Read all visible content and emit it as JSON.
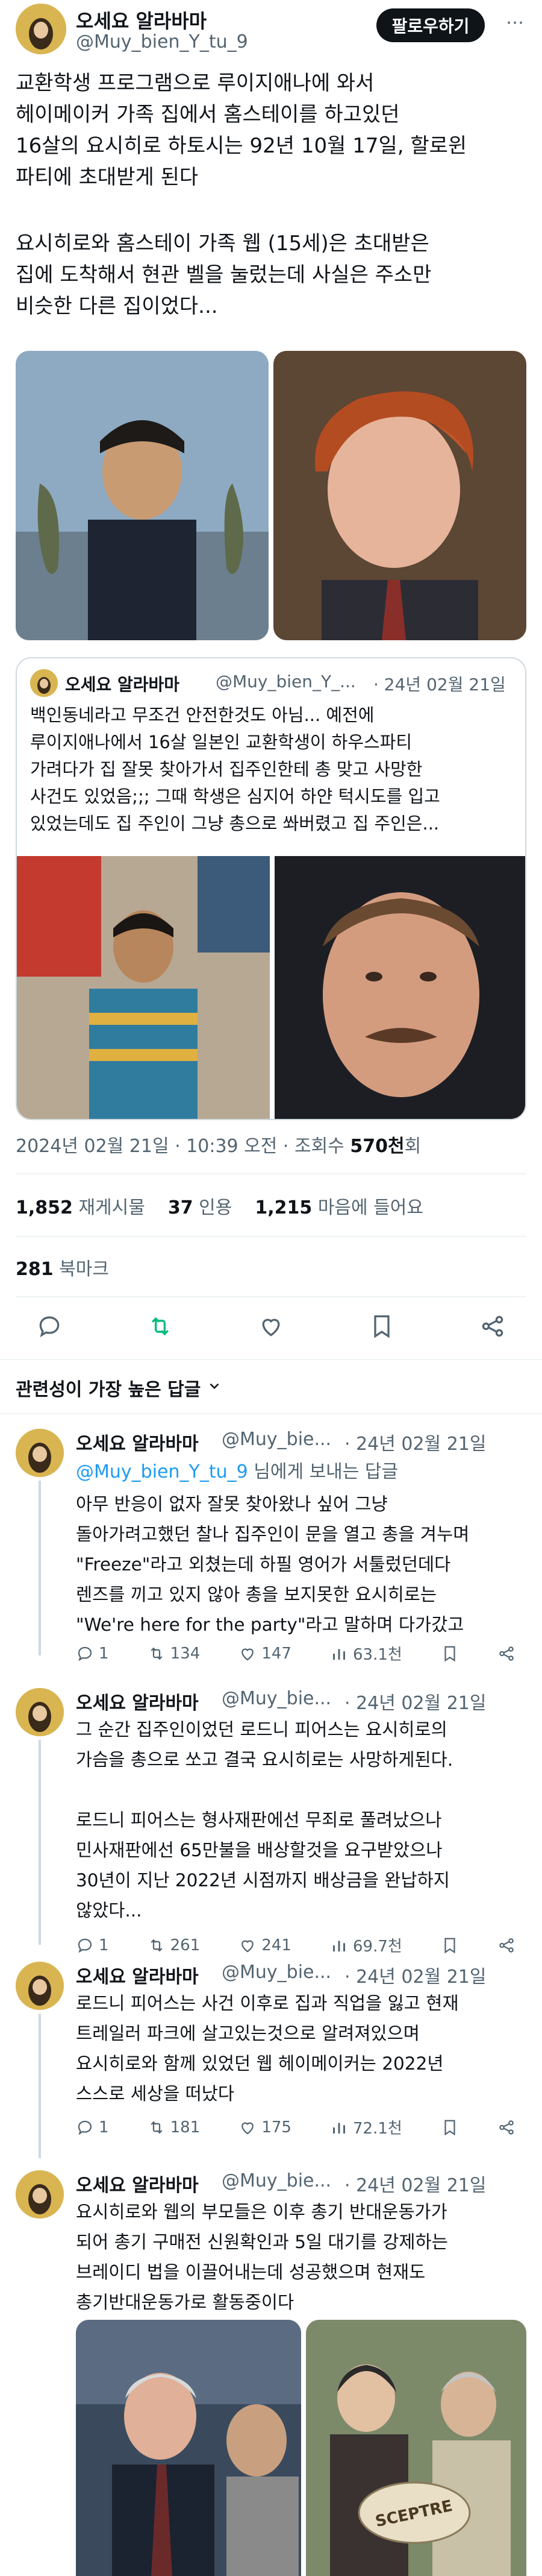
{
  "tweet": {
    "author_name": "오세요 알라바마",
    "author_handle": "@Muy_bien_Y_tu_9",
    "follow_label": "팔로우하기",
    "body_p1": "교환학생 프로그램으로 루이지애나에 와서\n헤이메이커 가족 집에서 홈스테이를 하고있던\n16살의 요시히로 하토시는 92년 10월 17일, 할로윈\n파티에 초대받게 된다",
    "body_p2": "요시히로와 홈스테이 가족 웹 (15세)은 초대받은\n집에 도착해서 현관 벨을 눌렀는데 사실은 주소만\n비슷한 다른 집이었다...",
    "timestamp": "2024년 02월 21일 · 10:39 오전 · 조회수",
    "views": "570천",
    "views_suffix": "회",
    "retweets": "1,852",
    "retweets_label": "재게시물",
    "quotes": "37",
    "quotes_label": "인용",
    "likes": "1,215",
    "likes_label": "마음에 들어요",
    "bookmarks": "281",
    "bookmarks_label": "북마크"
  },
  "quote": {
    "author_name": "오세요 알라바마",
    "author_handle": "@Muy_bien_Y_...",
    "date": "· 24년 02월 21일",
    "body": "백인동네라고 무조건 안전한것도 아님... 예전에\n루이지애나에서 16살 일본인 교환학생이 하우스파티\n가려다가 집 잘못 찾아가서 집주인한테 총 맞고 사망한\n사건도 있었음;;; 그때 학생은 심지어 하얀 턱시도를 입고\n있었는데도 집 주인이 그냥 총으로 쏴버렸고 집 주인은..."
  },
  "replies_header": "관련성이 가장 높은 답글",
  "replies": [
    {
      "author_name": "오세요 알라바마",
      "author_handle": "@Muy_bie...",
      "date": "· 24년 02월 21일",
      "reply_to_handle": "@Muy_bien_Y_tu_9",
      "reply_to_suffix": " 님에게 보내는 답글",
      "body": "아무 반응이 없자 잘못 찾아왔나 싶어 그냥\n돌아가려고했던 찰나 집주인이 문을 열고 총을 겨누며\n\"Freeze\"라고 외쳤는데 하필 영어가 서툴렀던데다\n렌즈를 끼고 있지 않아 총을 보지못한 요시히로는\n\"We're here for the party\"라고 말하며 다가갔고",
      "replies": "1",
      "retweets": "134",
      "likes": "147",
      "views": "63.1천"
    },
    {
      "author_name": "오세요 알라바마",
      "author_handle": "@Muy_bie...",
      "date": "· 24년 02월 21일",
      "body": "그 순간 집주인이었던 로드니 피어스는 요시히로의\n가슴을 총으로 쏘고 결국 요시히로는 사망하게된다.\n\n로드니 피어스는 형사재판에선 무죄로 풀려났으나\n민사재판에선 65만불을 배상할것을 요구받았으나\n30년이 지난 2022년 시점까지 배상금을 완납하지\n않았다...",
      "replies": "1",
      "retweets": "261",
      "likes": "241",
      "views": "69.7천"
    },
    {
      "author_name": "오세요 알라바마",
      "author_handle": "@Muy_bie...",
      "date": "· 24년 02월 21일",
      "body": "로드니 피어스는 사건 이후로 집과 직업을 잃고 현재\n트레일러 파크에 살고있는것으로 알려져있으며\n요시히로와 함께 있었던 웹 헤이메이커는 2022년\n스스로 세상을 떠났다",
      "replies": "1",
      "retweets": "181",
      "likes": "175",
      "views": "72.1천"
    },
    {
      "author_name": "오세요 알라바마",
      "author_handle": "@Muy_bie...",
      "date": "· 24년 02월 21일",
      "body": "요시히로와 웹의 부모들은 이후 총기 반대운동가가\n되어 총기 구매전 신원확인과 5일 대기를 강제하는\n브레이디 법을 이끌어내는데 성공했으며 현재도\n총기반대운동가로 활동중이다",
      "football_text": "SCEPTRE"
    }
  ],
  "colors": {
    "text": "#0f1419",
    "muted": "#536471",
    "link": "#1d9bf0",
    "retweet_green": "#00ba7c",
    "border": "#cfd9de"
  },
  "icons": [
    "reply-icon",
    "retweet-icon",
    "like-icon",
    "bookmark-icon",
    "share-icon",
    "views-icon",
    "chevron-down-icon"
  ]
}
